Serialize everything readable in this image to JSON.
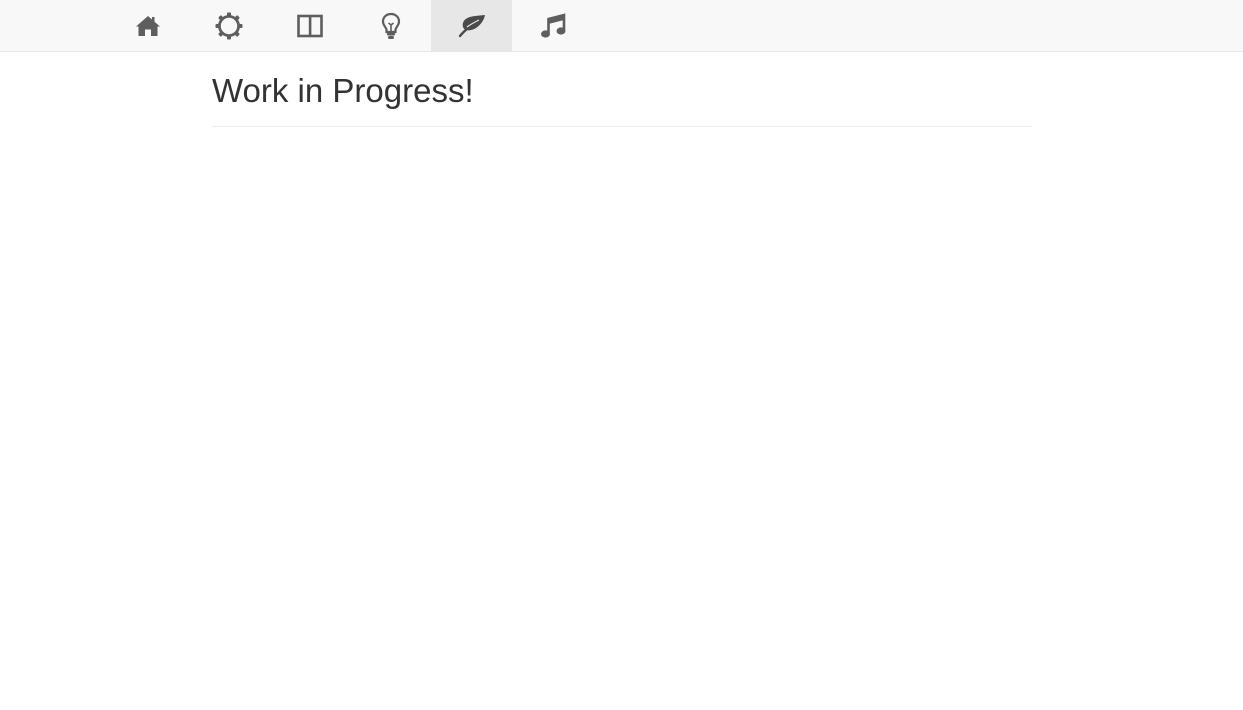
{
  "nav": {
    "items": [
      {
        "icon": "home-icon",
        "active": false
      },
      {
        "icon": "gear-icon",
        "active": false
      },
      {
        "icon": "columns-icon",
        "active": false
      },
      {
        "icon": "lightbulb-icon",
        "active": false
      },
      {
        "icon": "leaf-icon",
        "active": true
      },
      {
        "icon": "music-icon",
        "active": false
      }
    ],
    "icon_color": "#5e5e5e",
    "active_background": "#e7e7e7"
  },
  "main": {
    "title": "Work in Progress!"
  }
}
